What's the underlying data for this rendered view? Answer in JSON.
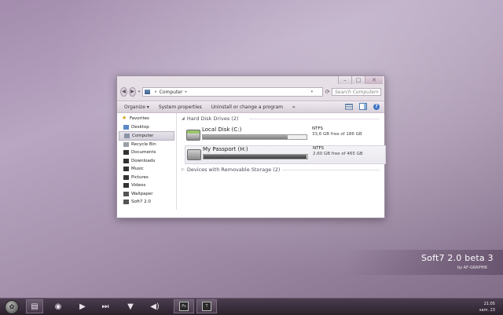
{
  "window": {
    "caption_buttons": [
      "minimize-icon",
      "maximize-icon",
      "close-icon"
    ],
    "address": {
      "crumb": "Computer",
      "chevron": "▸"
    },
    "search": {
      "placeholder": "Search Computer"
    },
    "toolbar": {
      "organize": "Organize ▾",
      "system_properties": "System properties",
      "uninstall": "Uninstall or change a program",
      "more": "»"
    }
  },
  "sidebar": {
    "items": [
      {
        "label": "Favorites",
        "icon": "star-icon"
      },
      {
        "label": "Desktop",
        "icon": "desktop-icon"
      },
      {
        "label": "Computer",
        "icon": "computer-icon",
        "selected": true
      },
      {
        "label": "Recycle Bin",
        "icon": "recycle-bin-icon"
      },
      {
        "label": "Documents",
        "icon": "documents-icon"
      },
      {
        "label": "Downloads",
        "icon": "downloads-icon"
      },
      {
        "label": "Music",
        "icon": "music-icon"
      },
      {
        "label": "Pictures",
        "icon": "pictures-icon"
      },
      {
        "label": "Videos",
        "icon": "videos-icon"
      },
      {
        "label": "Wallpaper",
        "icon": "folder-icon"
      },
      {
        "label": "Soft7 2.0",
        "icon": "folder-icon"
      }
    ]
  },
  "groups": {
    "hard_disk": "Hard Disk Drives (2)",
    "removable": "Devices with Removable Storage (2)"
  },
  "drives": [
    {
      "name": "Local Disk (C:)",
      "fs": "NTFS",
      "free": "33,6 GB free of 186 GB",
      "used_fraction": 0.82
    },
    {
      "name": "My Passport (H:)",
      "fs": "NTFS",
      "free": "2,60 GB free of 465 GB",
      "used_fraction": 0.99
    }
  ],
  "branding": {
    "title": "Soft7 2.0 beta 3",
    "subtitle": "by AF-GRAPHIK"
  },
  "taskbar": {
    "apps": [
      "explorer-icon",
      "firefox-icon",
      "play-icon",
      "next-icon",
      "fox-icon",
      "volume-icon",
      "tool-icon",
      "photoshop-icon",
      "text-app-icon"
    ],
    "photoshop_label": "Ps",
    "text_app_label": "T",
    "clock_time": "21:05",
    "clock_date": "sam. 23"
  },
  "colors": {
    "desktop": "#a38cad",
    "taskbar": "#3a2f3d",
    "accent": "#3d73c4"
  }
}
